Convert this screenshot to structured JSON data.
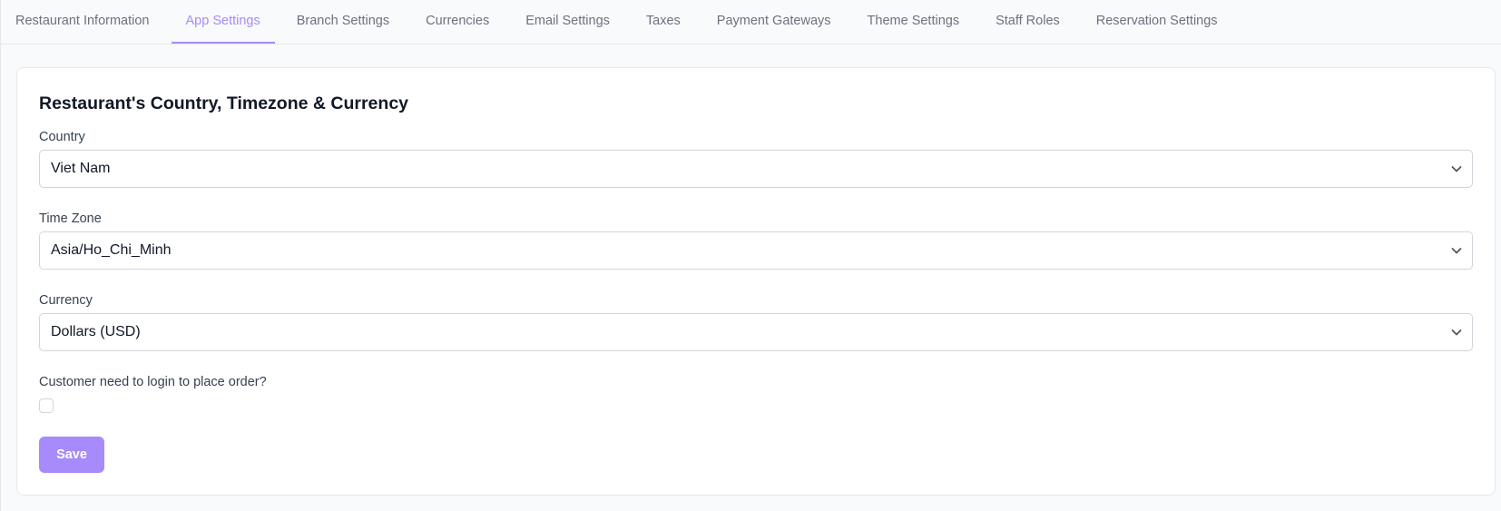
{
  "tabs": [
    {
      "label": "Restaurant Information",
      "active": false
    },
    {
      "label": "App Settings",
      "active": true
    },
    {
      "label": "Branch Settings",
      "active": false
    },
    {
      "label": "Currencies",
      "active": false
    },
    {
      "label": "Email Settings",
      "active": false
    },
    {
      "label": "Taxes",
      "active": false
    },
    {
      "label": "Payment Gateways",
      "active": false
    },
    {
      "label": "Theme Settings",
      "active": false
    },
    {
      "label": "Staff Roles",
      "active": false
    },
    {
      "label": "Reservation Settings",
      "active": false
    }
  ],
  "form": {
    "title": "Restaurant's Country, Timezone & Currency",
    "country": {
      "label": "Country",
      "value": "Viet Nam"
    },
    "timezone": {
      "label": "Time Zone",
      "value": "Asia/Ho_Chi_Minh"
    },
    "currency": {
      "label": "Currency",
      "value": "Dollars (USD)"
    },
    "login_required": {
      "label": "Customer need to login to place order?",
      "checked": false
    },
    "save_label": "Save"
  },
  "colors": {
    "accent": "#a78bfa",
    "border": "#e5e7eb",
    "background": "#f9fafb"
  },
  "icons": {
    "select_arrow": "chevron-down-icon"
  }
}
